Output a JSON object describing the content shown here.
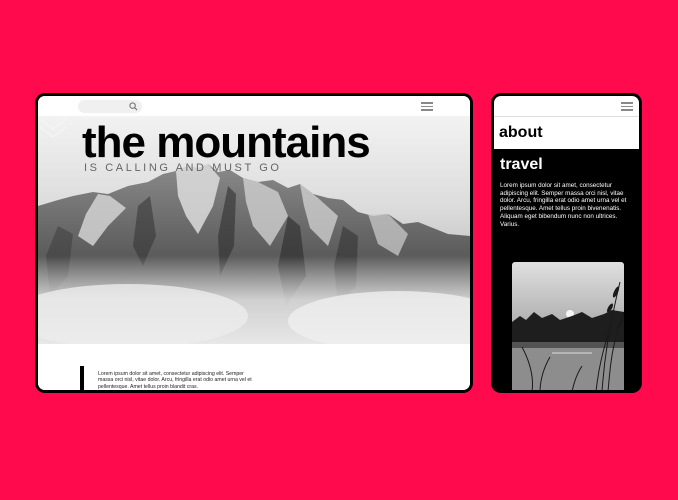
{
  "tablet": {
    "search": {
      "placeholder": ""
    },
    "hero": {
      "title": "the mountains",
      "subtitle": "IS CALLING AND MUST GO"
    },
    "body_text": "Lorem ipsum dolor sit amet, consectetur adipiscing elit. Semper massa orci nisl, vitae dolor. Arcu, fringilla erat odio amet urna vel et pellentesque. Amet tellus proin blandit cras."
  },
  "phone": {
    "about_title": "about",
    "travel_title": "travel",
    "body_text": "Lorem ipsum dolor sit amet, consectetur adipiscing elit. Semper massa orci nisl, vitae dolor. Arcu, fringilla erat odio amet urna vel et pellentesque. Amet tellus proin bivenenatis. Aliquam eget bibendum nunc non ultrices. Varius."
  },
  "colors": {
    "background": "#ff0a4d",
    "device_frame": "#000000",
    "text_dark": "#000000",
    "text_light": "#ffffff"
  },
  "icons": [
    "search-icon",
    "hamburger-menu-icon",
    "double-chevron-down-icon"
  ]
}
